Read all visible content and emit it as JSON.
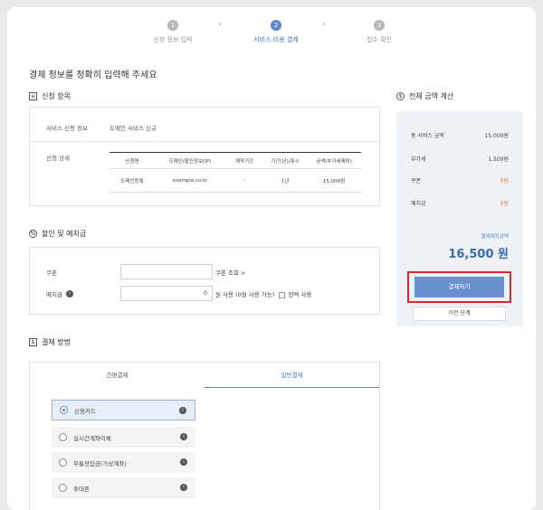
{
  "steps": [
    {
      "num": "1",
      "label": "신청 정보 입력"
    },
    {
      "num": "2",
      "label": "서비스 비용 결제"
    },
    {
      "num": "3",
      "label": "접수 확인"
    }
  ],
  "page_title": "결제 정보를 정확히 입력해 주세요",
  "application": {
    "heading": "신청 항목",
    "service_label": "서비스 신청 정보",
    "service_value": "도메인 서비스 신규",
    "detail_label": "신청 상세",
    "table_headers": [
      "신청명",
      "도메인/할인정보(IP)",
      "계약기간",
      "기간(년)/횟수",
      "금액(부가세제외)"
    ],
    "table_row": [
      "도메인등록",
      "example.co.kr",
      "-",
      "1년",
      "15,000원"
    ]
  },
  "discount": {
    "heading": "할인 및 예치금",
    "coupon_label": "쿠폰",
    "coupon_value": "",
    "coupon_link": "쿠폰 조회  >",
    "deposit_label": "예치금",
    "deposit_value": "0",
    "deposit_note": "원 사용 (0원 사용 가능)",
    "deposit_all": "전액 사용"
  },
  "payment": {
    "heading": "결제 방법",
    "tabs": [
      "간편결제",
      "일반결제"
    ],
    "methods": [
      "신용카드",
      "실시간계좌이체",
      "무통장입금(가상계좌)",
      "휴대폰"
    ]
  },
  "summary": {
    "heading": "전체 금액 계산",
    "rows": [
      {
        "label": "총 서비스 금액",
        "value": "15,000원"
      },
      {
        "label": "부가세",
        "value": "1,500원"
      },
      {
        "label": "쿠폰",
        "value": "0원"
      },
      {
        "label": "예치금",
        "value": "0원"
      }
    ],
    "total_label": "결제예정금액",
    "total_value": "16,500 원",
    "pay_button": "결제하기",
    "prev_button": "이전 단계"
  },
  "colors": {
    "accent": "#5b87c7",
    "highlight": "#d8262b",
    "zero": "#e8772e"
  }
}
